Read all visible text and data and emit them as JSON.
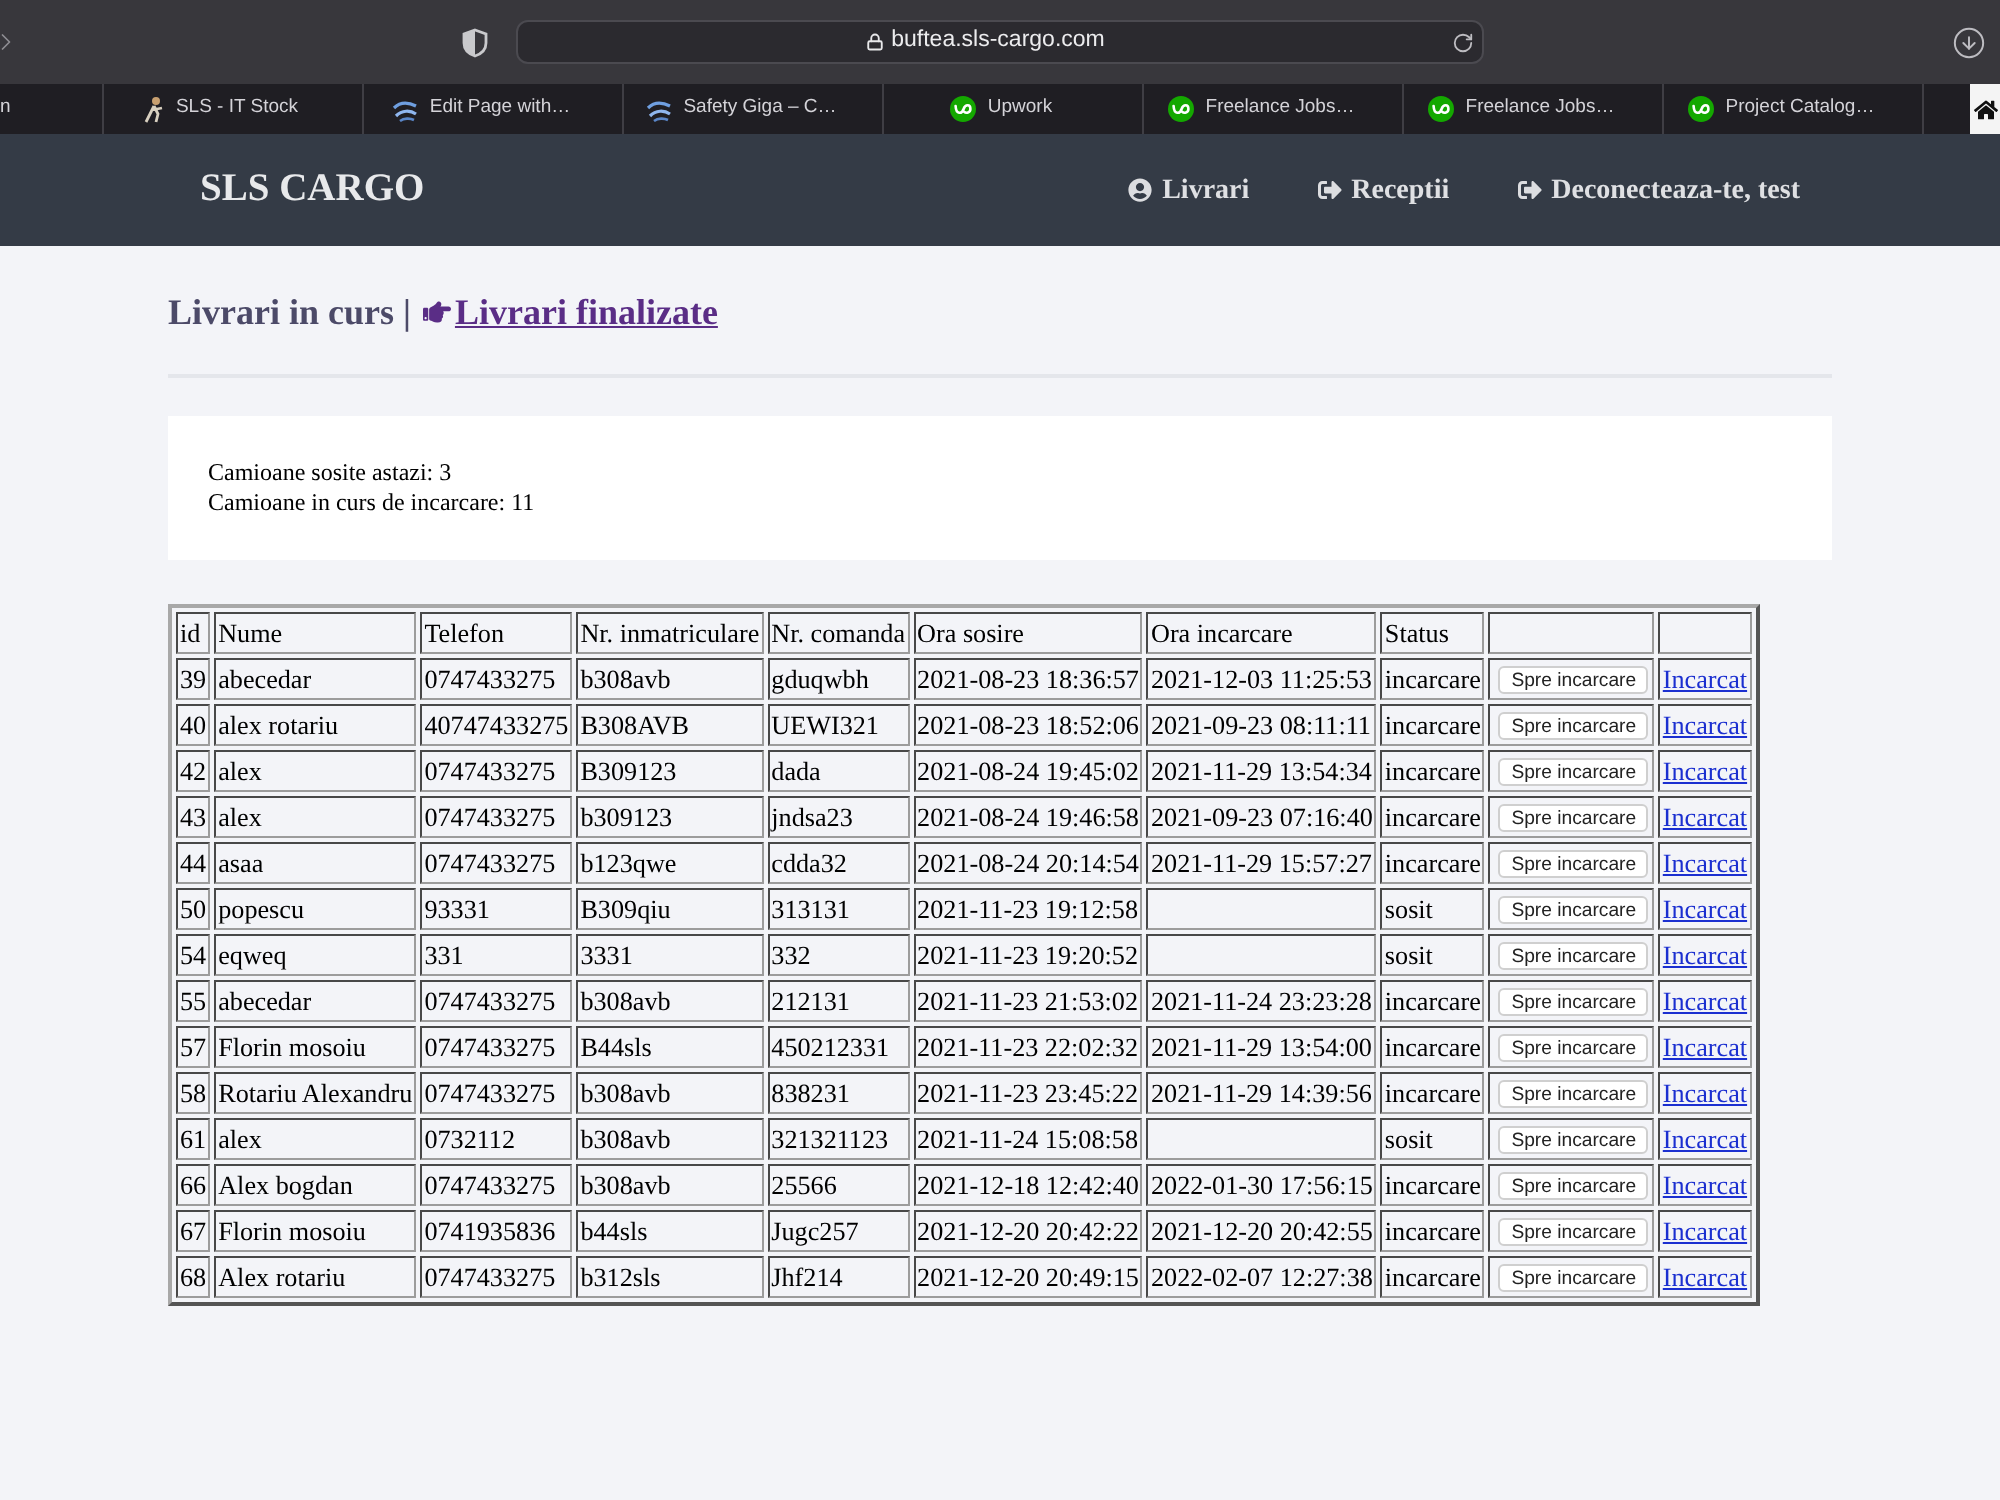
{
  "browser": {
    "url": "buftea.sls-cargo.com",
    "tabs": [
      {
        "title": "n",
        "kind": "plain"
      },
      {
        "title": "SLS - IT Stock",
        "kind": "figure"
      },
      {
        "title": "Edit Page with…",
        "kind": "swoosh"
      },
      {
        "title": "Safety Giga – C…",
        "kind": "swoosh"
      },
      {
        "title": "Upwork",
        "kind": "circle"
      },
      {
        "title": "Freelance Jobs…",
        "kind": "circle"
      },
      {
        "title": "Freelance Jobs…",
        "kind": "circle"
      },
      {
        "title": "Project Catalog…",
        "kind": "circle"
      }
    ]
  },
  "navbar": {
    "brand": "SLS CARGO",
    "links": [
      {
        "label": "Livrari",
        "kind": "user"
      },
      {
        "label": "Receptii",
        "kind": "exit"
      },
      {
        "label": "Deconecteaza-te, test",
        "kind": "exit"
      }
    ]
  },
  "heading": {
    "title": "Livrari in curs |",
    "link": "Livrari finalizate"
  },
  "summary": [
    "Camioane sosite astazi: 3",
    "Camioane in curs de incarcare: 11"
  ],
  "table": {
    "columns": [
      "id",
      "Nume",
      "Telefon",
      "Nr. inmatriculare",
      "Nr. comanda",
      "Ora sosire",
      "Ora incarcare",
      "Status"
    ],
    "rows": [
      {
        "id": "39",
        "name": "abecedar",
        "phone": "0747433275",
        "plate": "b308avb",
        "order": "gduqwbh",
        "arrival": "2021-08-23 18:36:57",
        "loading": "2021-12-03 11:25:53",
        "status": "incarcare",
        "action": "Spre incarcare",
        "link": "Incarcat"
      },
      {
        "id": "40",
        "name": "alex rotariu",
        "phone": "40747433275",
        "plate": "B308AVB",
        "order": "UEWI321",
        "arrival": "2021-08-23 18:52:06",
        "loading": "2021-09-23 08:11:11",
        "status": "incarcare",
        "action": "Spre incarcare",
        "link": "Incarcat"
      },
      {
        "id": "42",
        "name": "alex",
        "phone": "0747433275",
        "plate": "B309123",
        "order": "dada",
        "arrival": "2021-08-24 19:45:02",
        "loading": "2021-11-29 13:54:34",
        "status": "incarcare",
        "action": "Spre incarcare",
        "link": "Incarcat"
      },
      {
        "id": "43",
        "name": "alex",
        "phone": "0747433275",
        "plate": "b309123",
        "order": "jndsa23",
        "arrival": "2021-08-24 19:46:58",
        "loading": "2021-09-23 07:16:40",
        "status": "incarcare",
        "action": "Spre incarcare",
        "link": "Incarcat"
      },
      {
        "id": "44",
        "name": "asaa",
        "phone": "0747433275",
        "plate": "b123qwe",
        "order": "cdda32",
        "arrival": "2021-08-24 20:14:54",
        "loading": "2021-11-29 15:57:27",
        "status": "incarcare",
        "action": "Spre incarcare",
        "link": "Incarcat"
      },
      {
        "id": "50",
        "name": "popescu",
        "phone": "93331",
        "plate": "B309qiu",
        "order": "313131",
        "arrival": "2021-11-23 19:12:58",
        "status": "sosit",
        "action": "Spre incarcare",
        "link": "Incarcat"
      },
      {
        "id": "54",
        "name": "eqweq",
        "phone": "331",
        "plate": "3331",
        "order": "332",
        "arrival": "2021-11-23 19:20:52",
        "status": "sosit",
        "action": "Spre incarcare",
        "link": "Incarcat"
      },
      {
        "id": "55",
        "name": "abecedar",
        "phone": "0747433275",
        "plate": "b308avb",
        "order": "212131",
        "arrival": "2021-11-23 21:53:02",
        "loading": "2021-11-24 23:23:28",
        "status": "incarcare",
        "action": "Spre incarcare",
        "link": "Incarcat"
      },
      {
        "id": "57",
        "name": "Florin mosoiu",
        "phone": "0747433275",
        "plate": "B44sls",
        "order": "450212331",
        "arrival": "2021-11-23 22:02:32",
        "loading": "2021-11-29 13:54:00",
        "status": "incarcare",
        "action": "Spre incarcare",
        "link": "Incarcat"
      },
      {
        "id": "58",
        "name": "Rotariu Alexandru",
        "phone": "0747433275",
        "plate": "b308avb",
        "order": "838231",
        "arrival": "2021-11-23 23:45:22",
        "loading": "2021-11-29 14:39:56",
        "status": "incarcare",
        "action": "Spre incarcare",
        "link": "Incarcat"
      },
      {
        "id": "61",
        "name": "alex",
        "phone": "0732112",
        "plate": "b308avb",
        "order": "321321123",
        "arrival": "2021-11-24 15:08:58",
        "status": "sosit",
        "action": "Spre incarcare",
        "link": "Incarcat"
      },
      {
        "id": "66",
        "name": "Alex bogdan",
        "phone": "0747433275",
        "plate": "b308avb",
        "order": "25566",
        "arrival": "2021-12-18 12:42:40",
        "loading": "2022-01-30 17:56:15",
        "status": "incarcare",
        "action": "Spre incarcare",
        "link": "Incarcat"
      },
      {
        "id": "67",
        "name": "Florin mosoiu",
        "phone": "0741935836",
        "plate": "b44sls",
        "order": "Jugc257",
        "arrival": "2021-12-20 20:42:22",
        "loading": "2021-12-20 20:42:55",
        "status": "incarcare",
        "action": "Spre incarcare",
        "link": "Incarcat"
      },
      {
        "id": "68",
        "name": "Alex rotariu",
        "phone": "0747433275",
        "plate": "b312sls",
        "order": "Jhf214",
        "arrival": "2021-12-20 20:49:15",
        "loading": "2022-02-07 12:27:38",
        "status": "incarcare",
        "action": "Spre incarcare",
        "link": "Incarcat"
      }
    ]
  }
}
